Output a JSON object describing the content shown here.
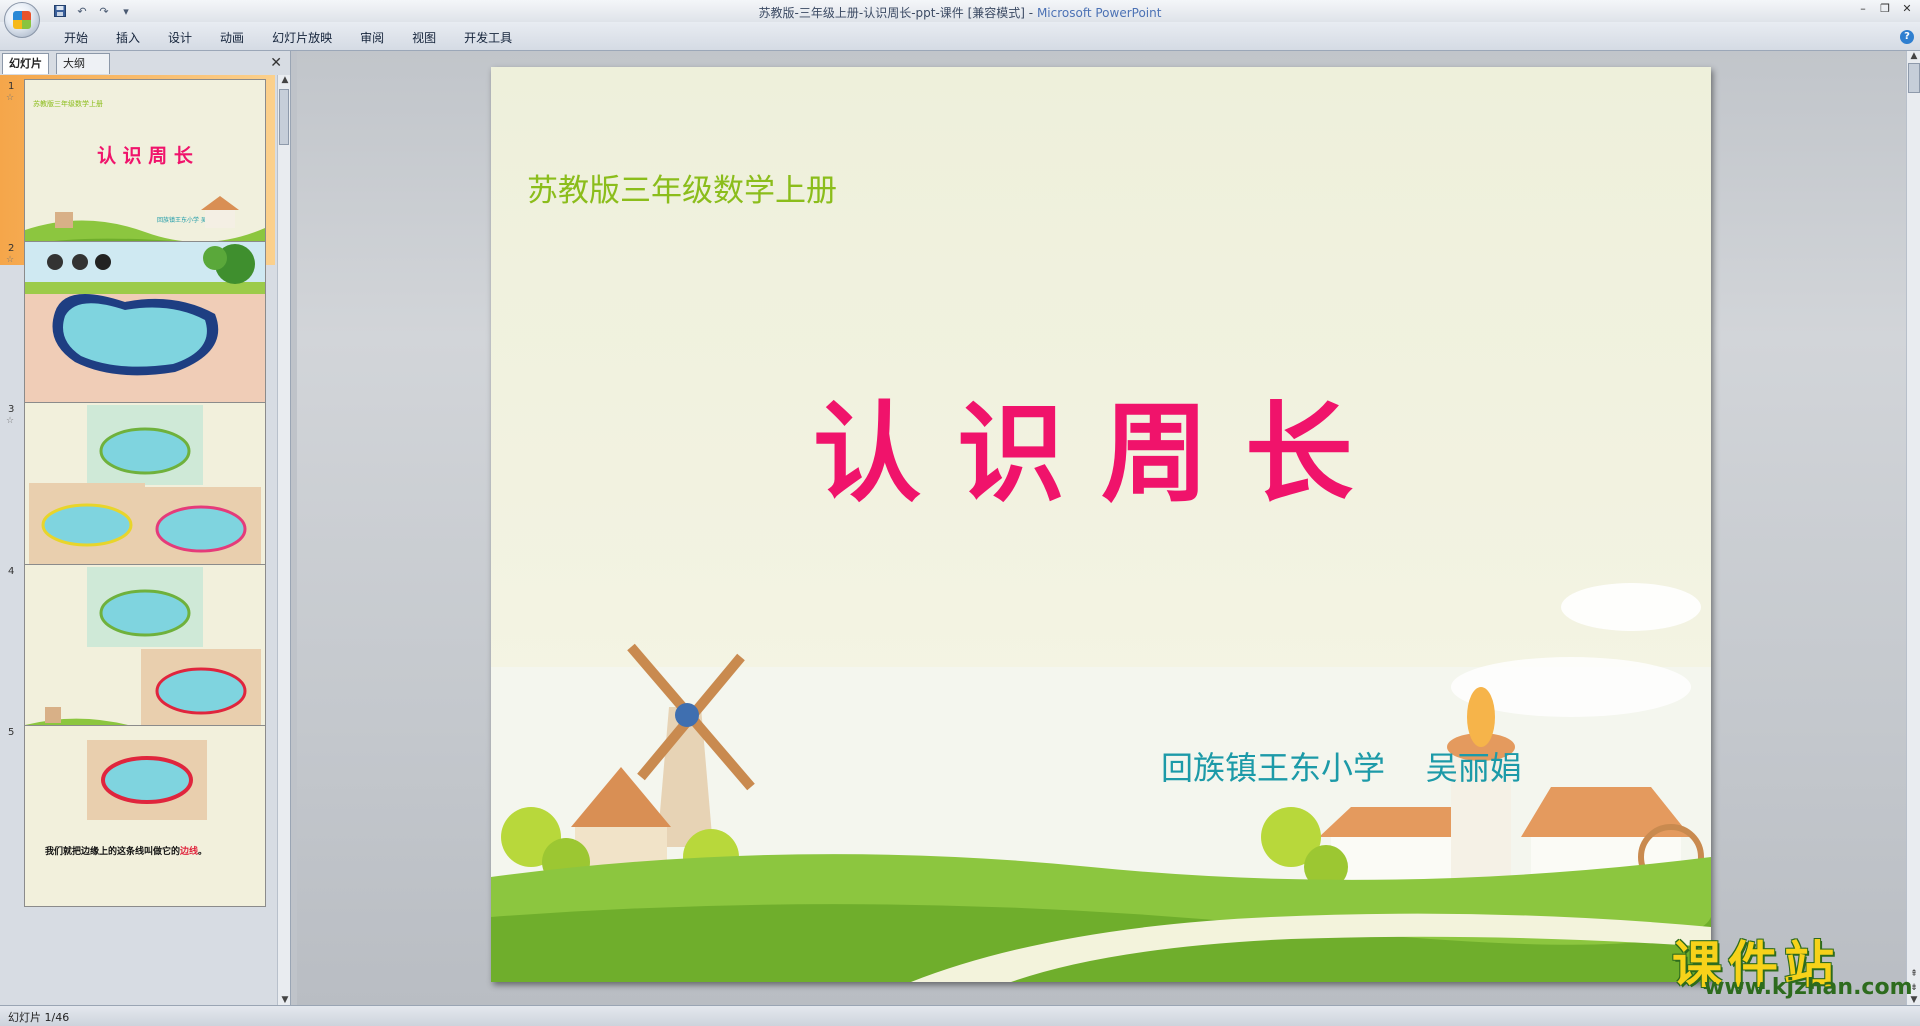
{
  "window": {
    "title_doc": "苏教版-三年级上册-认识周长-ppt-课件 [兼容模式] - ",
    "title_app": "Microsoft PowerPoint"
  },
  "ribbon": {
    "tabs": [
      "开始",
      "插入",
      "设计",
      "动画",
      "幻灯片放映",
      "审阅",
      "视图",
      "开发工具"
    ]
  },
  "panel": {
    "tab_slides": "幻灯片",
    "tab_outline": "大纲",
    "thumbnails": [
      {
        "num": "1",
        "anim": "☆",
        "title_small": "苏教版三年级数学上册",
        "title": "认 识 周 长",
        "footer": "回族镇王东小学  吴丽娟"
      },
      {
        "num": "2",
        "anim": "☆"
      },
      {
        "num": "3",
        "anim": "☆"
      },
      {
        "num": "4",
        "anim": ""
      },
      {
        "num": "5",
        "anim": "",
        "caption_a": "我们就把边缘上的这条线叫做它的",
        "caption_b": "边线",
        "caption_c": "。"
      }
    ]
  },
  "slide": {
    "subtitle": "苏教版三年级数学上册",
    "title": "认识周长",
    "author": "回族镇王东小学    吴丽娟"
  },
  "status": {
    "slide_counter": "幻灯片 1/46"
  },
  "watermark": {
    "main": "课件站",
    "url": "www.kjzhan.com"
  },
  "colors": {
    "title_pink": "#f0136b",
    "subtitle_green": "#8bbd1b",
    "author_teal": "#1c9aa8",
    "selection_orange": "#f5a64a"
  }
}
